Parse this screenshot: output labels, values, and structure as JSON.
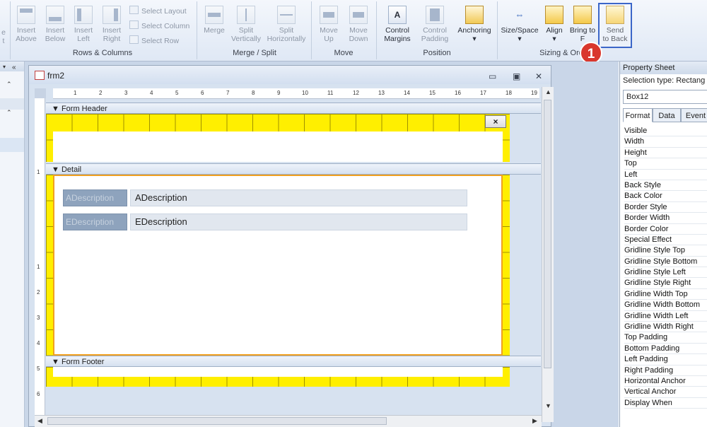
{
  "ribbon": {
    "rows_columns": {
      "label": "Rows & Columns",
      "insert_above": "Insert Above",
      "insert_below": "Insert Below",
      "insert_left": "Insert Left",
      "insert_right": "Insert Right",
      "select_layout": "Select Layout",
      "select_column": "Select Column",
      "select_row": "Select Row"
    },
    "merge_split": {
      "label": "Merge / Split",
      "merge": "Merge",
      "split_vertically": "Split Vertically",
      "split_horizontally": "Split Horizontally"
    },
    "move": {
      "label": "Move",
      "move_up": "Move Up",
      "move_down": "Move Down"
    },
    "position": {
      "label": "Position",
      "control_margins": "Control Margins",
      "control_padding": "Control Padding",
      "anchoring": "Anchoring"
    },
    "sizing_ordering": {
      "label": "Sizing & Ord",
      "size_space": "Size/Space",
      "align": "Align",
      "bring_to_front": "Bring to F",
      "send_to_back_1": "Send",
      "send_to_back_2": "to Back"
    },
    "partial_left_1": "e",
    "partial_left_2": "t"
  },
  "callout_number": "1",
  "form_window": {
    "title": "frm2",
    "ruler_numbers": [
      "1",
      "2",
      "3",
      "4",
      "5",
      "6",
      "7",
      "8",
      "9",
      "10",
      "11",
      "12",
      "13",
      "14",
      "15",
      "16",
      "17",
      "18",
      "19"
    ],
    "vruler_numbers": [
      "1",
      "1",
      "2",
      "3",
      "4",
      "5",
      "6",
      "1"
    ],
    "sections": {
      "header": "Form Header",
      "detail": "Detail",
      "footer": "Form Footer"
    },
    "close_button": "×",
    "fields": [
      {
        "label": "ADescription",
        "value": "ADescription"
      },
      {
        "label": "EDescription",
        "value": "EDescription"
      }
    ]
  },
  "property_sheet": {
    "title": "Property Sheet",
    "selection_type": "Selection type:  Rectang",
    "selected_object": "Box12",
    "tabs": [
      "Format",
      "Data",
      "Event"
    ],
    "active_tab": "Format",
    "properties": [
      "Visible",
      "Width",
      "Height",
      "Top",
      "Left",
      "Back Style",
      "Back Color",
      "Border Style",
      "Border Width",
      "Border Color",
      "Special Effect",
      "Gridline Style Top",
      "Gridline Style Bottom",
      "Gridline Style Left",
      "Gridline Style Right",
      "Gridline Width Top",
      "Gridline Width Bottom",
      "Gridline Width Left",
      "Gridline Width Right",
      "Top Padding",
      "Bottom Padding",
      "Left Padding",
      "Right Padding",
      "Horizontal Anchor",
      "Vertical Anchor",
      "Display When"
    ]
  },
  "colors": {
    "grid_yellow": "#ffef00",
    "highlight_blue": "#3b66c8",
    "callout_red": "#d9372d",
    "label_bg": "#8ea3bd"
  },
  "icons": [
    "insert-above-icon",
    "insert-below-icon",
    "insert-left-icon",
    "insert-right-icon",
    "merge-icon",
    "split-vertically-icon",
    "split-horizontally-icon",
    "move-up-icon",
    "move-down-icon",
    "control-margins-icon",
    "control-padding-icon",
    "anchoring-icon",
    "size-space-icon",
    "align-icon",
    "bring-to-front-icon",
    "send-to-back-icon",
    "form-icon",
    "minimize-icon",
    "maximize-icon",
    "close-icon"
  ]
}
